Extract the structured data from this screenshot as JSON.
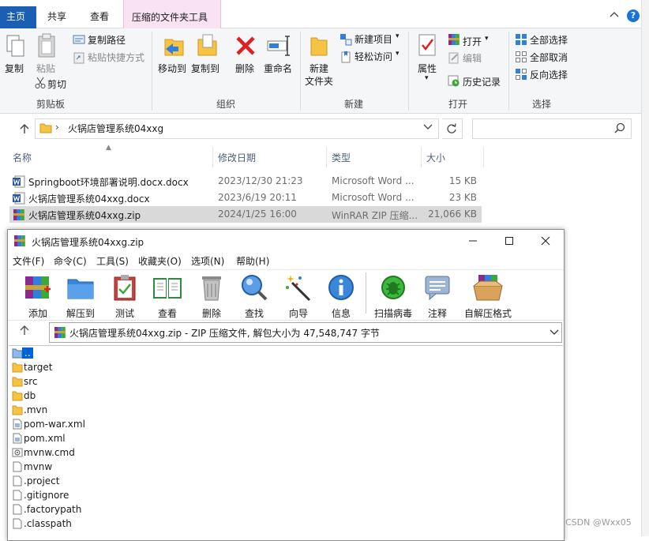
{
  "ribbon": {
    "tabs": {
      "home": "主页",
      "share": "共享",
      "view": "查看",
      "zip_tools": "压缩的文件夹工具"
    },
    "clipboard": {
      "copy": "复制",
      "paste": "粘贴",
      "copy_path": "复制路径",
      "paste_shortcut": "粘贴快捷方式",
      "cut": "剪切",
      "group": "剪贴板"
    },
    "organize": {
      "move_to": "移动到",
      "copy_to": "复制到",
      "delete": "删除",
      "rename": "重命名",
      "group": "组织"
    },
    "new": {
      "new_folder": "新建",
      "new_folder_2": "文件夹",
      "new_item": "新建项目",
      "easy_access": "轻松访问",
      "group": "新建"
    },
    "open": {
      "properties": "属性",
      "open": "打开",
      "edit": "编辑",
      "history": "历史记录",
      "group": "打开"
    },
    "select": {
      "select_all": "全部选择",
      "select_none": "全部取消",
      "invert": "反向选择",
      "group": "选择"
    }
  },
  "address": {
    "path": "火锅店管理系统04xxg"
  },
  "file_list": {
    "columns": {
      "name": "名称",
      "date": "修改日期",
      "type": "类型",
      "size": "大小"
    },
    "rows": [
      {
        "name": "Springboot环境部署说明.docx.docx",
        "date": "2023/12/30 21:23",
        "type": "Microsoft Word ...",
        "size": "15 KB"
      },
      {
        "name": "火锅店管理系统04xxg.docx",
        "date": "2023/6/19 20:11",
        "type": "Microsoft Word ...",
        "size": "23 KB"
      },
      {
        "name": "火锅店管理系统04xxg.zip",
        "date": "2024/1/25 16:00",
        "type": "WinRAR ZIP 压缩...",
        "size": "21,066 KB"
      }
    ]
  },
  "winrar": {
    "title": "火锅店管理系统04xxg.zip",
    "menu": [
      "文件(F)",
      "命令(C)",
      "工具(S)",
      "收藏夹(O)",
      "选项(N)",
      "帮助(H)"
    ],
    "toolbar": {
      "add": "添加",
      "extract_to": "解压到",
      "test": "测试",
      "view": "查看",
      "delete": "删除",
      "find": "查找",
      "wizard": "向导",
      "info": "信息",
      "virus_scan": "扫描病毒",
      "comment": "注释",
      "sfx": "自解压格式"
    },
    "path": "火锅店管理系统04xxg.zip - ZIP 压缩文件, 解包大小为 47,548,747 字节",
    "entries": [
      "..",
      "target",
      "src",
      "db",
      ".mvn",
      "pom-war.xml",
      "pom.xml",
      "mvnw.cmd",
      "mvnw",
      ".project",
      ".gitignore",
      ".factorypath",
      ".classpath"
    ]
  },
  "watermark": "CSDN @Wxx05",
  "colors": {
    "accent": "#1a5fb4",
    "zip_tab": "#f9e2f1",
    "selection": "#0063d4",
    "folder": "#f6c343"
  }
}
